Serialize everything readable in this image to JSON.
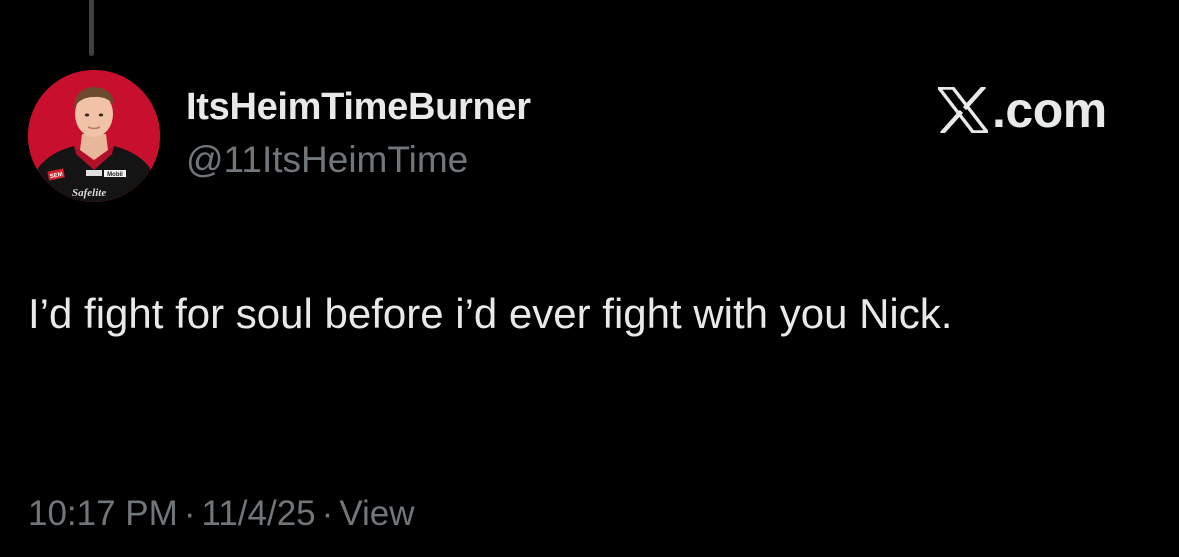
{
  "tweet": {
    "display_name": "ItsHeimTimeBurner",
    "handle": "@11ItsHeimTime",
    "text": "I’d fight for soul before i’d ever fight with you Nick.",
    "time": "10:17 PM",
    "date": "11/4/25",
    "separator": "·",
    "view_label": "View",
    "avatar_icon": "driver-avatar"
  },
  "watermark": {
    "logo_icon": "x-logo-icon",
    "suffix": ".com"
  },
  "avatar_sponsors": {
    "left_patch": "SEM",
    "chest": "Mobil",
    "collar": "Safelite"
  },
  "colors": {
    "background": "#000000",
    "primary_text": "#e7e9ea",
    "secondary_text": "#71767b",
    "avatar_bg": "#c41230"
  }
}
